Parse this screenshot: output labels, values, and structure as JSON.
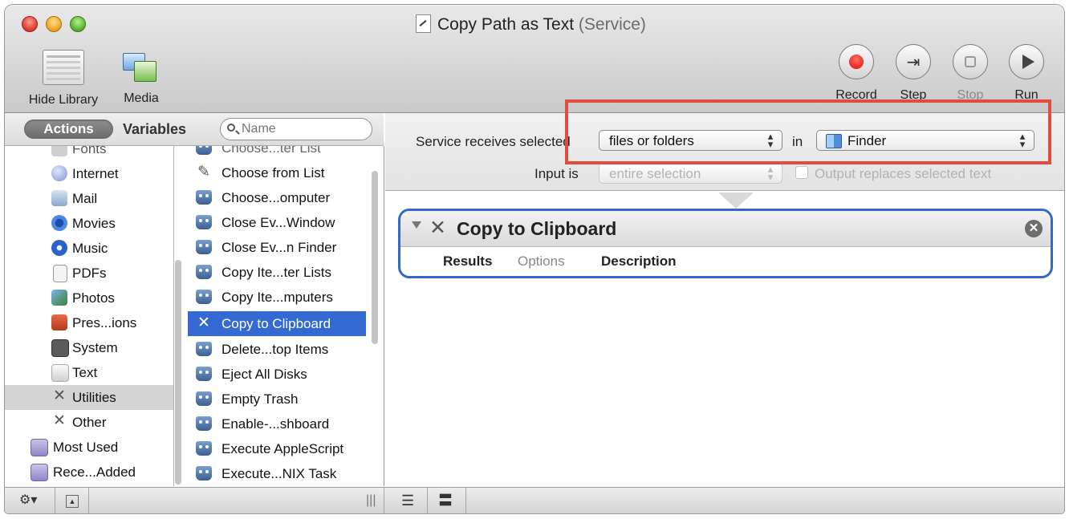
{
  "window": {
    "title": "Copy Path as Text",
    "title_suffix": "(Service)"
  },
  "toolbar": {
    "hide_library_label": "Hide Library",
    "media_label": "Media",
    "record_label": "Record",
    "step_label": "Step",
    "stop_label": "Stop",
    "run_label": "Run"
  },
  "library": {
    "tab_actions": "Actions",
    "tab_variables": "Variables",
    "search_placeholder": "Name",
    "categories": [
      {
        "label": "Fonts",
        "icon": "fonts-icon"
      },
      {
        "label": "Internet",
        "icon": "internet-icon"
      },
      {
        "label": "Mail",
        "icon": "mail-icon"
      },
      {
        "label": "Movies",
        "icon": "movies-icon"
      },
      {
        "label": "Music",
        "icon": "music-icon"
      },
      {
        "label": "PDFs",
        "icon": "pdfs-icon"
      },
      {
        "label": "Photos",
        "icon": "photos-icon"
      },
      {
        "label": "Pres...ions",
        "icon": "presentations-icon"
      },
      {
        "label": "System",
        "icon": "system-icon"
      },
      {
        "label": "Text",
        "icon": "text-icon"
      },
      {
        "label": "Utilities",
        "icon": "utilities-icon",
        "selected": true
      },
      {
        "label": "Other",
        "icon": "other-icon"
      },
      {
        "label": "Most Used",
        "icon": "smart-folder-icon"
      },
      {
        "label": "Rece...Added",
        "icon": "smart-folder-icon"
      }
    ],
    "actions": [
      {
        "label": "Choose...ter List",
        "icon": "automator-robot-icon"
      },
      {
        "label": "Choose from List",
        "icon": "tool-icon"
      },
      {
        "label": "Choose...omputer",
        "icon": "automator-robot-icon"
      },
      {
        "label": "Close Ev...Window",
        "icon": "automator-robot-icon"
      },
      {
        "label": "Close Ev...n Finder",
        "icon": "automator-robot-icon"
      },
      {
        "label": "Copy Ite...ter Lists",
        "icon": "automator-robot-icon"
      },
      {
        "label": "Copy Ite...mputers",
        "icon": "automator-robot-icon"
      },
      {
        "label": "Copy to Clipboard",
        "icon": "tools-icon",
        "selected": true
      },
      {
        "label": "Delete...top Items",
        "icon": "automator-robot-icon"
      },
      {
        "label": "Eject All Disks",
        "icon": "automator-robot-icon"
      },
      {
        "label": "Empty Trash",
        "icon": "automator-robot-icon"
      },
      {
        "label": "Enable-...shboard",
        "icon": "automator-robot-icon"
      },
      {
        "label": "Execute AppleScript",
        "icon": "automator-robot-icon"
      },
      {
        "label": "Execute...NIX Task",
        "icon": "automator-robot-icon"
      }
    ]
  },
  "service": {
    "receives_label": "Service receives selected",
    "receives_value": "files or folders",
    "in_label": "in",
    "app_value": "Finder",
    "input_label": "Input is",
    "input_value": "entire selection",
    "output_label": "Output replaces selected text"
  },
  "workflow": {
    "action_title": "Copy to Clipboard",
    "tabs": [
      "Results",
      "Options",
      "Description"
    ]
  },
  "colors": {
    "selection": "#3469d1",
    "highlight_box": "#e14c3c",
    "record": "#e01010"
  }
}
